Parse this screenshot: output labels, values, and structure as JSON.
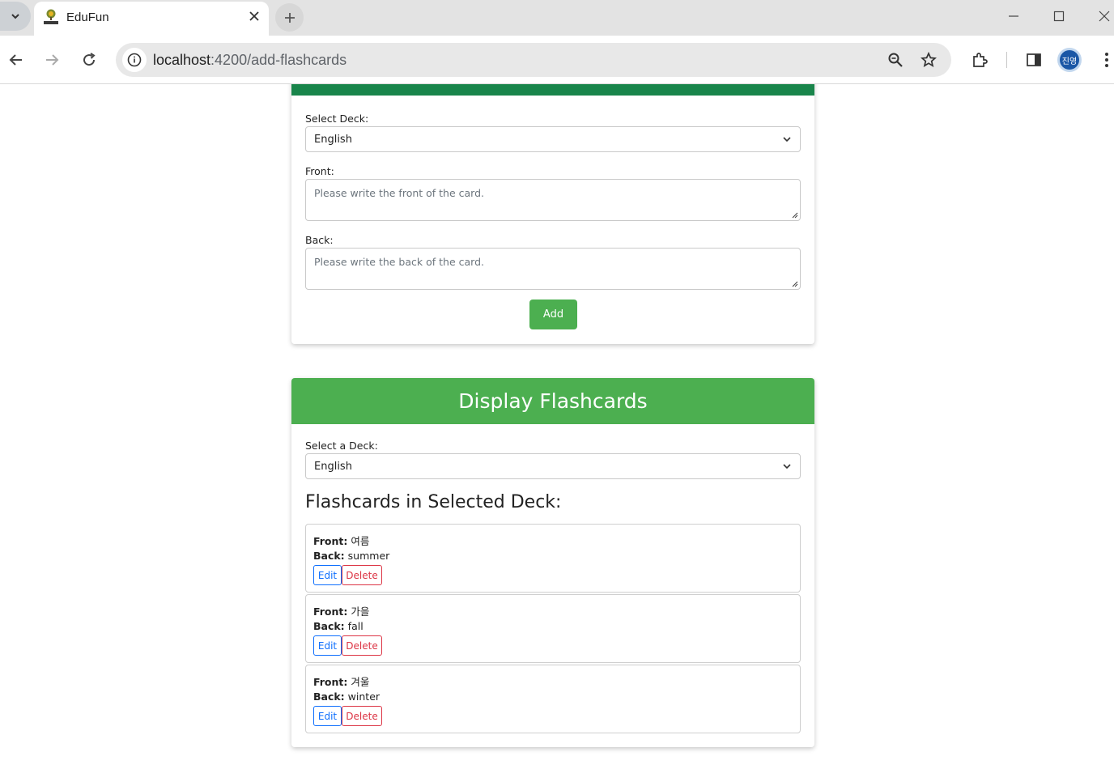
{
  "browser": {
    "tab_title": "EduFun",
    "url_host": "localhost",
    "url_path": ":4200/add-flashcards",
    "profile_initials": "진영"
  },
  "add_form": {
    "deck_label": "Select Deck:",
    "deck_value": "English",
    "front_label": "Front:",
    "front_placeholder": "Please write the front of the card.",
    "back_label": "Back:",
    "back_placeholder": "Please write the back of the card.",
    "add_label": "Add"
  },
  "display": {
    "title": "Display Flashcards",
    "deck_label": "Select a Deck:",
    "deck_value": "English",
    "list_heading": "Flashcards in Selected Deck:",
    "front_key": "Front:",
    "back_key": "Back:",
    "edit_label": "Edit",
    "delete_label": "Delete",
    "cards": [
      {
        "front": "여름",
        "back": "summer"
      },
      {
        "front": "가을",
        "back": "fall"
      },
      {
        "front": "겨울",
        "back": "winter"
      }
    ]
  },
  "colors": {
    "header_green": "#4caf50",
    "top_bar_green": "#19854b",
    "edit_blue": "#0d6efd",
    "delete_red": "#dc3545"
  }
}
